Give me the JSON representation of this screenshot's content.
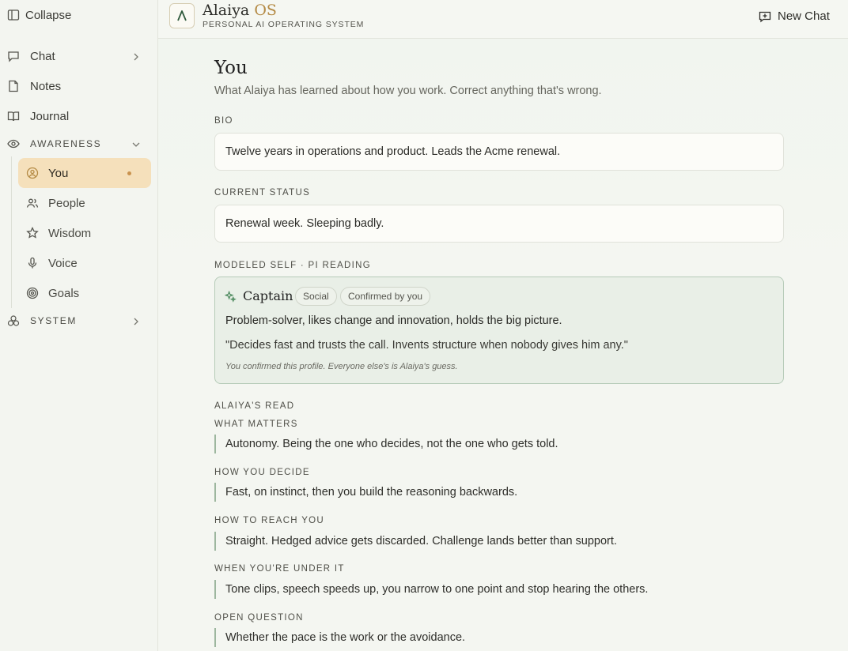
{
  "sidebar": {
    "collapse_label": "Collapse",
    "items": [
      {
        "label": "Chat",
        "icon": "chat-icon"
      },
      {
        "label": "Notes",
        "icon": "note-icon"
      },
      {
        "label": "Journal",
        "icon": "book-icon"
      }
    ],
    "awareness_label": "AWARENESS",
    "awareness_items": [
      {
        "label": "You",
        "icon": "user-circle-icon",
        "active": true
      },
      {
        "label": "People",
        "icon": "people-icon"
      },
      {
        "label": "Wisdom",
        "icon": "star-icon"
      },
      {
        "label": "Voice",
        "icon": "microphone-icon"
      },
      {
        "label": "Goals",
        "icon": "target-icon"
      }
    ],
    "system_label": "SYSTEM"
  },
  "header": {
    "brand_name": "Alaiya",
    "brand_os": "OS",
    "brand_sub": "PERSONAL AI OPERATING SYSTEM",
    "new_chat_label": "New Chat"
  },
  "main": {
    "title": "You",
    "subtitle": "What Alaiya has learned about how you work. Correct anything that's wrong.",
    "bio_label": "BIO",
    "bio_value": "Twelve years in operations and product. Leads the Acme renewal.",
    "status_label": "CURRENT STATUS",
    "status_value": "Renewal week. Sleeping badly.",
    "modeled_label": "MODELED SELF · PI READING",
    "profile": {
      "name": "Captain",
      "tag": "Social",
      "confirmed": "Confirmed by you",
      "description": "Problem-solver, likes change and innovation, holds the big picture.",
      "quote": "\"Decides fast and trusts the call. Invents structure when nobody gives him any.\"",
      "note": "You confirmed this profile. Everyone else's is Alaiya's guess."
    },
    "read_label": "ALAIYA'S READ",
    "reads": [
      {
        "label": "WHAT MATTERS",
        "text": "Autonomy. Being the one who decides, not the one who gets told."
      },
      {
        "label": "HOW YOU DECIDE",
        "text": "Fast, on instinct, then you build the reasoning backwards."
      },
      {
        "label": "HOW TO REACH YOU",
        "text": "Straight. Hedged advice gets discarded. Challenge lands better than support."
      },
      {
        "label": "WHEN YOU'RE UNDER IT",
        "text": "Tone clips, speech speeds up, you narrow to one point and stop hearing the others."
      },
      {
        "label": "OPEN QUESTION",
        "text": "Whether the pace is the work or the avoidance."
      }
    ]
  },
  "colors": {
    "accent_active_bg": "#f5e0bb",
    "active_dot": "#c9924e",
    "brand_os": "#b48a44",
    "card_border": "#b6cbb8",
    "read_rule": "#9db79f"
  }
}
